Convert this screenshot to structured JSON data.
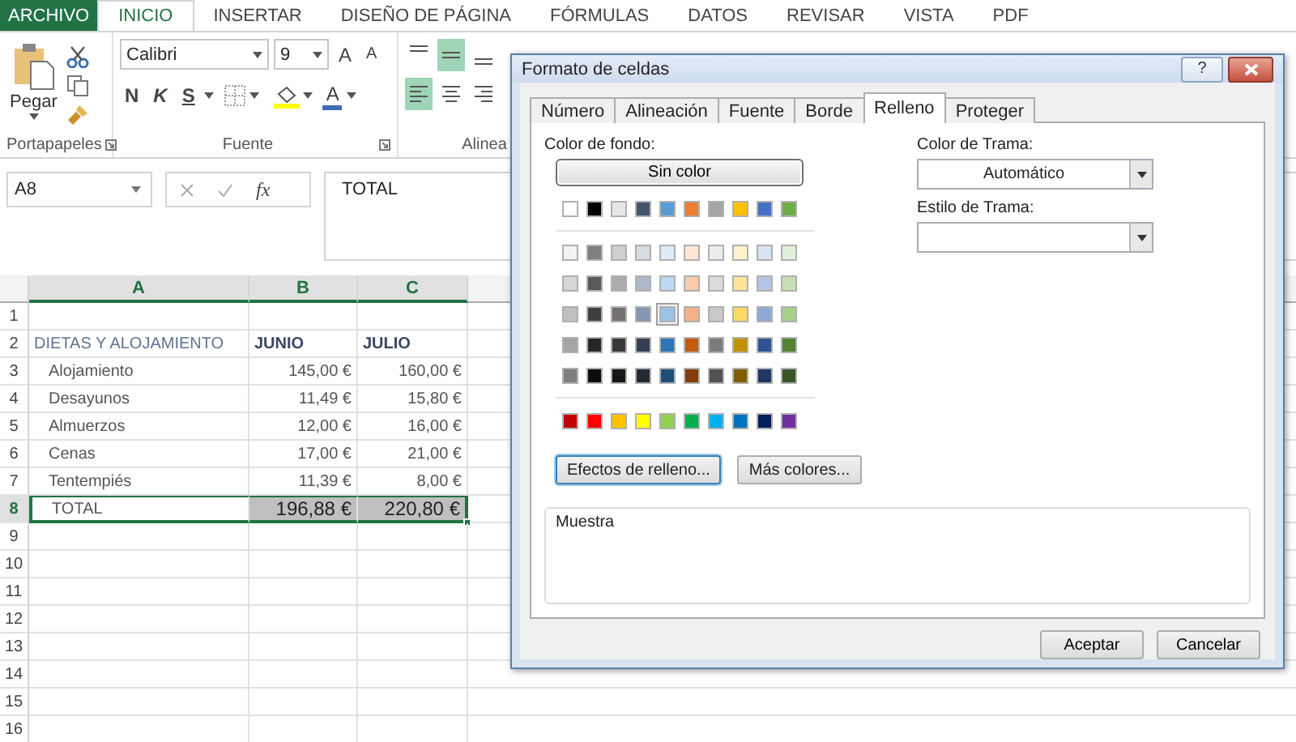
{
  "ribbon_tabs": [
    {
      "label": "ARCHIVO",
      "kind": "file",
      "selected": false
    },
    {
      "label": "INICIO",
      "kind": "tab",
      "selected": true
    },
    {
      "label": "INSERTAR",
      "kind": "tab",
      "selected": false
    },
    {
      "label": "DISEÑO DE PÁGINA",
      "kind": "tab",
      "selected": false
    },
    {
      "label": "FÓRMULAS",
      "kind": "tab",
      "selected": false
    },
    {
      "label": "DATOS",
      "kind": "tab",
      "selected": false
    },
    {
      "label": "REVISAR",
      "kind": "tab",
      "selected": false
    },
    {
      "label": "VISTA",
      "kind": "tab",
      "selected": false
    },
    {
      "label": "PDF",
      "kind": "tab",
      "selected": false
    }
  ],
  "clipboard": {
    "paste_label": "Pegar",
    "group_label": "Portapapeles"
  },
  "font": {
    "font_name": "Calibri",
    "font_size": "9",
    "bold": "N",
    "italic": "K",
    "underline": "S",
    "grow": "A",
    "shrink": "A",
    "font_color_letter": "A",
    "group_label": "Fuente"
  },
  "alignment": {
    "group_label": "Alinea",
    "top_row": [
      {
        "kind": "top",
        "selected": false
      },
      {
        "kind": "middle",
        "selected": true
      },
      {
        "kind": "bottom",
        "selected": false
      }
    ],
    "bottom_row": [
      {
        "kind": "left",
        "selected": true
      },
      {
        "kind": "center",
        "selected": false
      },
      {
        "kind": "right",
        "selected": false
      }
    ]
  },
  "formula_bar": {
    "name_box": "A8",
    "function_label": "fx",
    "value": "TOTAL"
  },
  "sheet": {
    "columns": [
      {
        "label": "A",
        "selected": true
      },
      {
        "label": "B",
        "selected": true
      },
      {
        "label": "C",
        "selected": true
      }
    ],
    "rows": [
      {
        "number": "1",
        "selected": false,
        "cells": []
      },
      {
        "number": "2",
        "selected": false,
        "cells": [
          {
            "text": "DIETAS Y ALOJAMIENTO",
            "kind": "title"
          },
          {
            "text": "JUNIO",
            "kind": "header"
          },
          {
            "text": "JULIO",
            "kind": "header"
          }
        ]
      },
      {
        "number": "3",
        "selected": false,
        "cells": [
          {
            "text": "Alojamiento",
            "kind": "item"
          },
          {
            "text": "145,00 €",
            "kind": "number"
          },
          {
            "text": "160,00 €",
            "kind": "number"
          }
        ]
      },
      {
        "number": "4",
        "selected": false,
        "cells": [
          {
            "text": "Desayunos",
            "kind": "item"
          },
          {
            "text": "11,49 €",
            "kind": "number"
          },
          {
            "text": "15,80 €",
            "kind": "number"
          }
        ]
      },
      {
        "number": "5",
        "selected": false,
        "cells": [
          {
            "text": "Almuerzos",
            "kind": "item"
          },
          {
            "text": "12,00 €",
            "kind": "number"
          },
          {
            "text": "16,00 €",
            "kind": "number"
          }
        ]
      },
      {
        "number": "6",
        "selected": false,
        "cells": [
          {
            "text": "Cenas",
            "kind": "item"
          },
          {
            "text": "17,00 €",
            "kind": "number"
          },
          {
            "text": "21,00 €",
            "kind": "number"
          }
        ]
      },
      {
        "number": "7",
        "selected": false,
        "cells": [
          {
            "text": "Tentempiés",
            "kind": "item"
          },
          {
            "text": "11,39 €",
            "kind": "number"
          },
          {
            "text": "8,00 €",
            "kind": "number"
          }
        ]
      },
      {
        "number": "8",
        "selected": true,
        "cells": [
          {
            "text": "TOTAL",
            "kind": "item"
          },
          {
            "text": "196,88 €",
            "kind": "total"
          },
          {
            "text": "220,80 €",
            "kind": "total"
          }
        ]
      },
      {
        "number": "9",
        "selected": false,
        "cells": []
      },
      {
        "number": "10",
        "selected": false,
        "cells": []
      },
      {
        "number": "11",
        "selected": false,
        "cells": []
      },
      {
        "number": "12",
        "selected": false,
        "cells": []
      },
      {
        "number": "13",
        "selected": false,
        "cells": []
      },
      {
        "number": "14",
        "selected": false,
        "cells": []
      },
      {
        "number": "15",
        "selected": false,
        "cells": []
      },
      {
        "number": "16",
        "selected": false,
        "cells": []
      }
    ]
  },
  "dialog": {
    "title": "Formato de celdas",
    "help": "?",
    "tabs": [
      {
        "label": "Número",
        "selected": false
      },
      {
        "label": "Alineación",
        "selected": false
      },
      {
        "label": "Fuente",
        "selected": false
      },
      {
        "label": "Borde",
        "selected": false
      },
      {
        "label": "Relleno",
        "selected": true
      },
      {
        "label": "Proteger",
        "selected": false
      }
    ],
    "background_label": "Color de fondo:",
    "no_color": "Sin color",
    "theme_colors": [
      {
        "color": "#ffffff",
        "selected": false
      },
      {
        "color": "#000000",
        "selected": false
      },
      {
        "color": "#e7e6e6",
        "selected": false
      },
      {
        "color": "#44546a",
        "selected": false
      },
      {
        "color": "#5b9bd5",
        "selected": false
      },
      {
        "color": "#ed7d31",
        "selected": false
      },
      {
        "color": "#a5a5a5",
        "selected": false
      },
      {
        "color": "#ffc000",
        "selected": false
      },
      {
        "color": "#4472c4",
        "selected": false
      },
      {
        "color": "#70ad47",
        "selected": false
      }
    ],
    "tints": [
      [
        {
          "color": "#f2f2f2",
          "selected": false
        },
        {
          "color": "#7f7f7f",
          "selected": false
        },
        {
          "color": "#d0cece",
          "selected": false
        },
        {
          "color": "#d6dce4",
          "selected": false
        },
        {
          "color": "#deebf6",
          "selected": false
        },
        {
          "color": "#fbe5d5",
          "selected": false
        },
        {
          "color": "#ededed",
          "selected": false
        },
        {
          "color": "#fff2cc",
          "selected": false
        },
        {
          "color": "#dae3f3",
          "selected": false
        },
        {
          "color": "#e2efd9",
          "selected": false
        }
      ],
      [
        {
          "color": "#d8d8d8",
          "selected": false
        },
        {
          "color": "#595959",
          "selected": false
        },
        {
          "color": "#aeabab",
          "selected": false
        },
        {
          "color": "#adb9ca",
          "selected": false
        },
        {
          "color": "#bdd7ee",
          "selected": false
        },
        {
          "color": "#f7cbac",
          "selected": false
        },
        {
          "color": "#dbdbdb",
          "selected": false
        },
        {
          "color": "#fee599",
          "selected": false
        },
        {
          "color": "#b4c6e7",
          "selected": false
        },
        {
          "color": "#c5e0b3",
          "selected": false
        }
      ],
      [
        {
          "color": "#bfbfbf",
          "selected": false
        },
        {
          "color": "#3f3f3f",
          "selected": false
        },
        {
          "color": "#757070",
          "selected": false
        },
        {
          "color": "#8496b0",
          "selected": false
        },
        {
          "color": "#9cc3e5",
          "selected": true
        },
        {
          "color": "#f4b183",
          "selected": false
        },
        {
          "color": "#c9c9c9",
          "selected": false
        },
        {
          "color": "#ffd965",
          "selected": false
        },
        {
          "color": "#8eaadb",
          "selected": false
        },
        {
          "color": "#a8d08d",
          "selected": false
        }
      ],
      [
        {
          "color": "#a5a5a5",
          "selected": false
        },
        {
          "color": "#262626",
          "selected": false
        },
        {
          "color": "#3a3838",
          "selected": false
        },
        {
          "color": "#323f4f",
          "selected": false
        },
        {
          "color": "#2e75b5",
          "selected": false
        },
        {
          "color": "#c55a11",
          "selected": false
        },
        {
          "color": "#7b7b7b",
          "selected": false
        },
        {
          "color": "#bf9000",
          "selected": false
        },
        {
          "color": "#2f5496",
          "selected": false
        },
        {
          "color": "#538135",
          "selected": false
        }
      ],
      [
        {
          "color": "#7f7f7f",
          "selected": false
        },
        {
          "color": "#0c0c0c",
          "selected": false
        },
        {
          "color": "#171616",
          "selected": false
        },
        {
          "color": "#222a35",
          "selected": false
        },
        {
          "color": "#1e4e79",
          "selected": false
        },
        {
          "color": "#833c0b",
          "selected": false
        },
        {
          "color": "#525252",
          "selected": false
        },
        {
          "color": "#7f6000",
          "selected": false
        },
        {
          "color": "#1f3864",
          "selected": false
        },
        {
          "color": "#375623",
          "selected": false
        }
      ]
    ],
    "standard_colors": [
      {
        "color": "#c00000",
        "selected": false
      },
      {
        "color": "#ff0000",
        "selected": false
      },
      {
        "color": "#ffc000",
        "selected": false
      },
      {
        "color": "#ffff00",
        "selected": false
      },
      {
        "color": "#92d050",
        "selected": false
      },
      {
        "color": "#00b050",
        "selected": false
      },
      {
        "color": "#00b0f0",
        "selected": false
      },
      {
        "color": "#0070c0",
        "selected": false
      },
      {
        "color": "#002060",
        "selected": false
      },
      {
        "color": "#7030a0",
        "selected": false
      }
    ],
    "effect_buttons": [
      {
        "label": "Efectos de relleno...",
        "focused": true
      },
      {
        "label": "Más colores...",
        "focused": false
      }
    ],
    "pattern_color_label": "Color de Trama:",
    "pattern_color": "Automático",
    "pattern_style_label": "Estilo de Trama:",
    "sample_label": "Muestra",
    "ok": "Aceptar",
    "cancel": "Cancelar"
  }
}
